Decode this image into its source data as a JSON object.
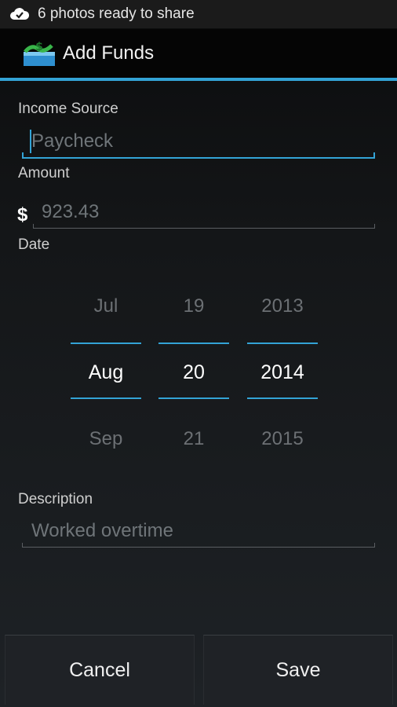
{
  "status_bar": {
    "notification_text": "6 photos ready to share",
    "icon": "cloud-check-icon"
  },
  "action_bar": {
    "title": "Add Funds",
    "icon": "money-stack-icon"
  },
  "form": {
    "income_source": {
      "label": "Income Source",
      "placeholder": "Paycheck",
      "value": ""
    },
    "amount": {
      "label": "Amount",
      "currency_symbol": "$",
      "placeholder": "923.43"
    },
    "date": {
      "label": "Date",
      "month": {
        "prev": "Jul",
        "selected": "Aug",
        "next": "Sep"
      },
      "day": {
        "prev": "19",
        "selected": "20",
        "next": "21"
      },
      "year": {
        "prev": "2013",
        "selected": "2014",
        "next": "2015"
      }
    },
    "description": {
      "label": "Description",
      "placeholder": "Worked overtime"
    }
  },
  "buttons": {
    "cancel": "Cancel",
    "save": "Save"
  },
  "colors": {
    "accent": "#33a3d6",
    "background_top": "#0b0c0d",
    "background_bottom": "#1e2226"
  }
}
